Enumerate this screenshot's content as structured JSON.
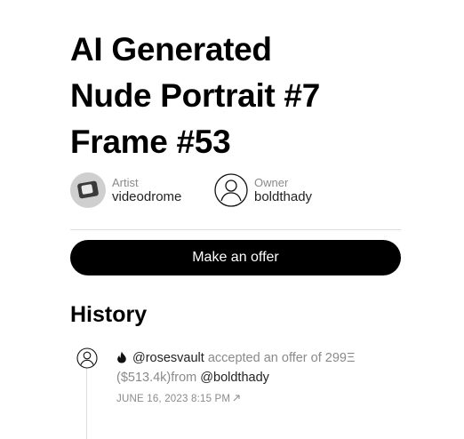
{
  "artwork": {
    "title_lines": [
      "AI Generated",
      "Nude Portrait #7",
      "Frame #53"
    ]
  },
  "artist": {
    "role": "Artist",
    "name": "videodrome"
  },
  "owner": {
    "role": "Owner",
    "name": "boldthady"
  },
  "actions": {
    "offer_label": "Make an offer"
  },
  "history": {
    "heading": "History",
    "events": [
      {
        "actor": "@rosesvault",
        "action": " accepted an offer of ",
        "amount": "299Ξ",
        "usd": "($513.4k)",
        "from_word": "from ",
        "counterparty": "@boldthady",
        "date": "JUNE 16, 2023 8:15 PM"
      }
    ]
  },
  "icons": {
    "artist_avatar": "artist-avatar-image",
    "owner_avatar": "user-outline-icon",
    "event_avatar": "user-outline-icon",
    "event_type": "flame-icon",
    "date_link": "arrow-up-right-icon"
  }
}
